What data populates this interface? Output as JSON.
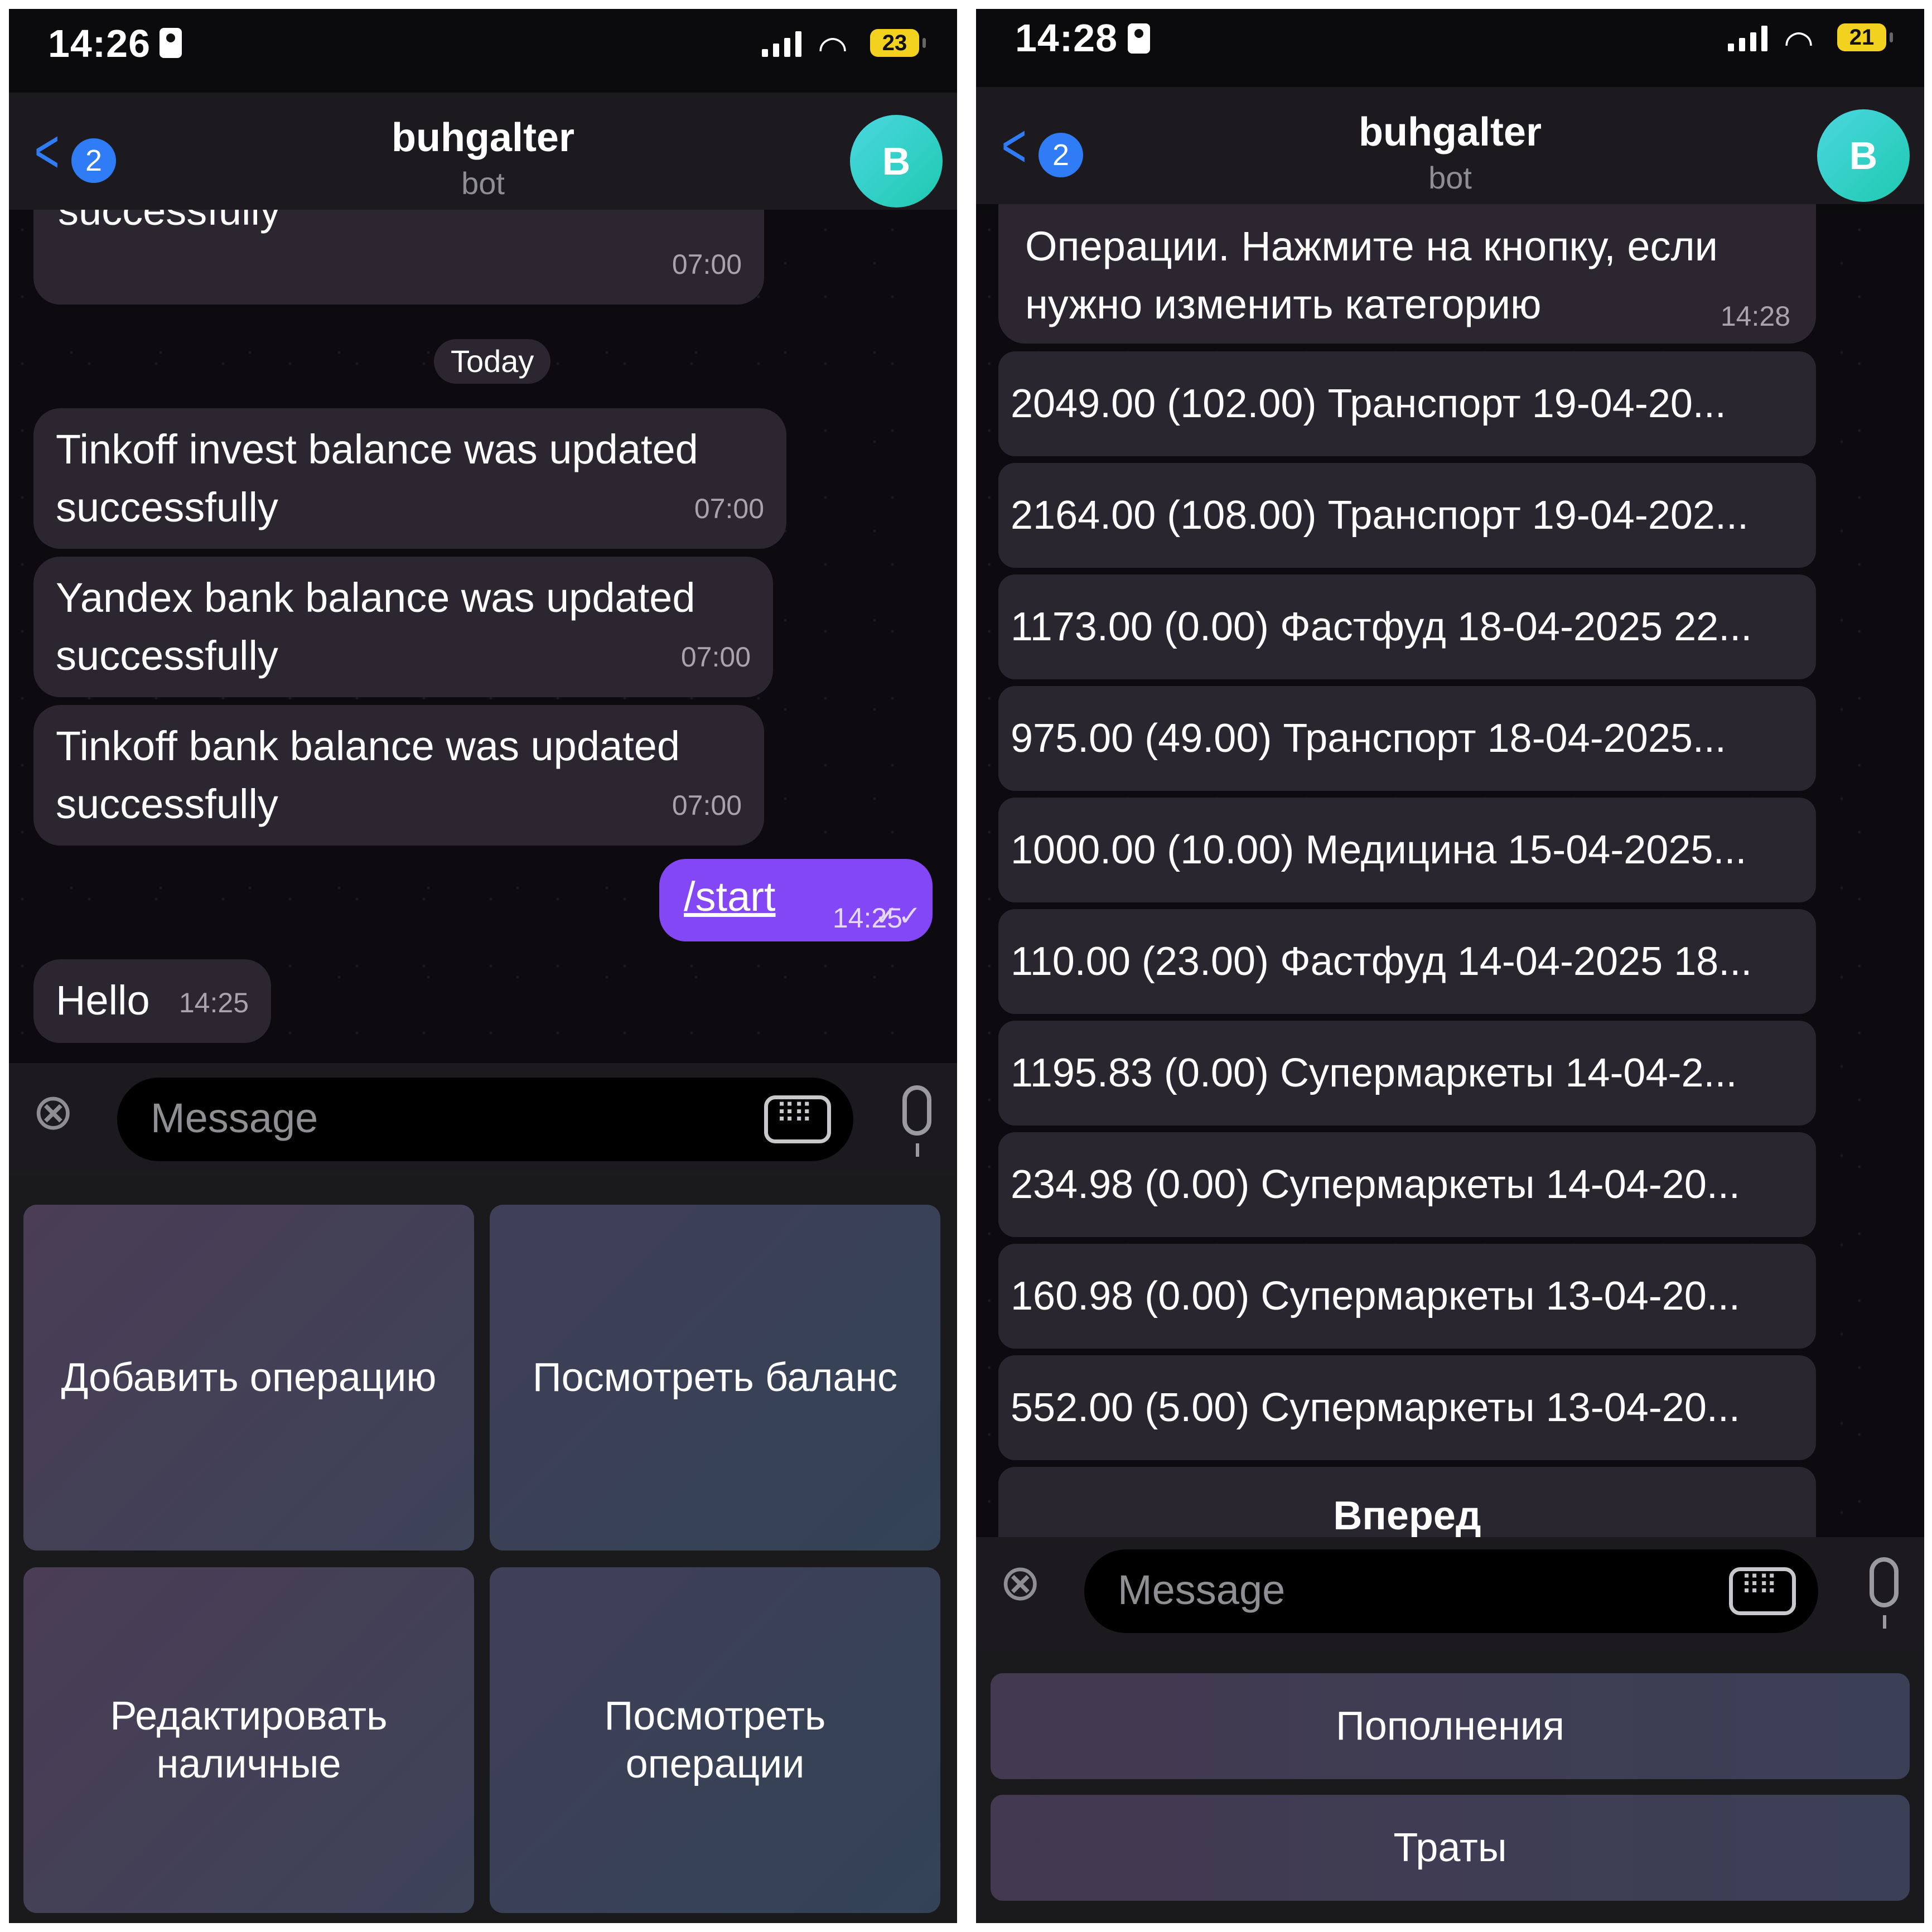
{
  "left": {
    "status": {
      "time": "14:26",
      "battery": "23"
    },
    "header": {
      "back_count": "2",
      "title": "buhgalter",
      "subtitle": "bot",
      "avatar": "B"
    },
    "messages": [
      {
        "text": "Tinkoff bank balance was updated successfully",
        "time": "07:00",
        "partial": true
      },
      {
        "text": "Tinkoff invest balance was updated successfully",
        "time": "07:00"
      },
      {
        "text": "Yandex bank balance was updated successfully",
        "time": "07:00"
      },
      {
        "text": "Tinkoff bank balance was updated successfully",
        "time": "07:00"
      }
    ],
    "date_separator": "Today",
    "outgoing": {
      "text": "/start",
      "time": "14:25"
    },
    "reply": {
      "text": "Hello",
      "time": "14:25"
    },
    "composer": {
      "placeholder": "Message"
    },
    "keyboard": [
      {
        "label": "Добавить операцию"
      },
      {
        "label": "Посмотреть баланс"
      },
      {
        "label": "Редактировать наличные"
      },
      {
        "label": "Посмотреть операции"
      }
    ]
  },
  "right": {
    "status": {
      "time": "14:28",
      "battery": "21"
    },
    "header": {
      "back_count": "2",
      "title": "buhgalter",
      "subtitle": "bot",
      "avatar": "B"
    },
    "top_message": {
      "text": "Операции. Нажмите на кнопку, если нужно изменить категорию",
      "time": "14:28"
    },
    "operations": [
      "2049.00 (102.00) Транспорт 19-04-20...",
      "2164.00 (108.00) Транспорт 19-04-202...",
      "1173.00 (0.00) Фастфуд 18-04-2025 22...",
      "975.00 (49.00) Транспорт 18-04-2025...",
      "1000.00 (10.00) Медицина 15-04-2025...",
      "110.00 (23.00) Фастфуд 14-04-2025 18...",
      "1195.83 (0.00) Супермаркеты 14-04-2...",
      "234.98 (0.00) Супермаркеты 14-04-20...",
      "160.98 (0.00) Супермаркеты 13-04-20...",
      "552.00 (5.00) Супермаркеты 13-04-20..."
    ],
    "next_button": "Вперед",
    "composer": {
      "placeholder": "Message"
    },
    "keyboard": [
      {
        "label": "Пополнения"
      },
      {
        "label": "Траты"
      }
    ]
  }
}
